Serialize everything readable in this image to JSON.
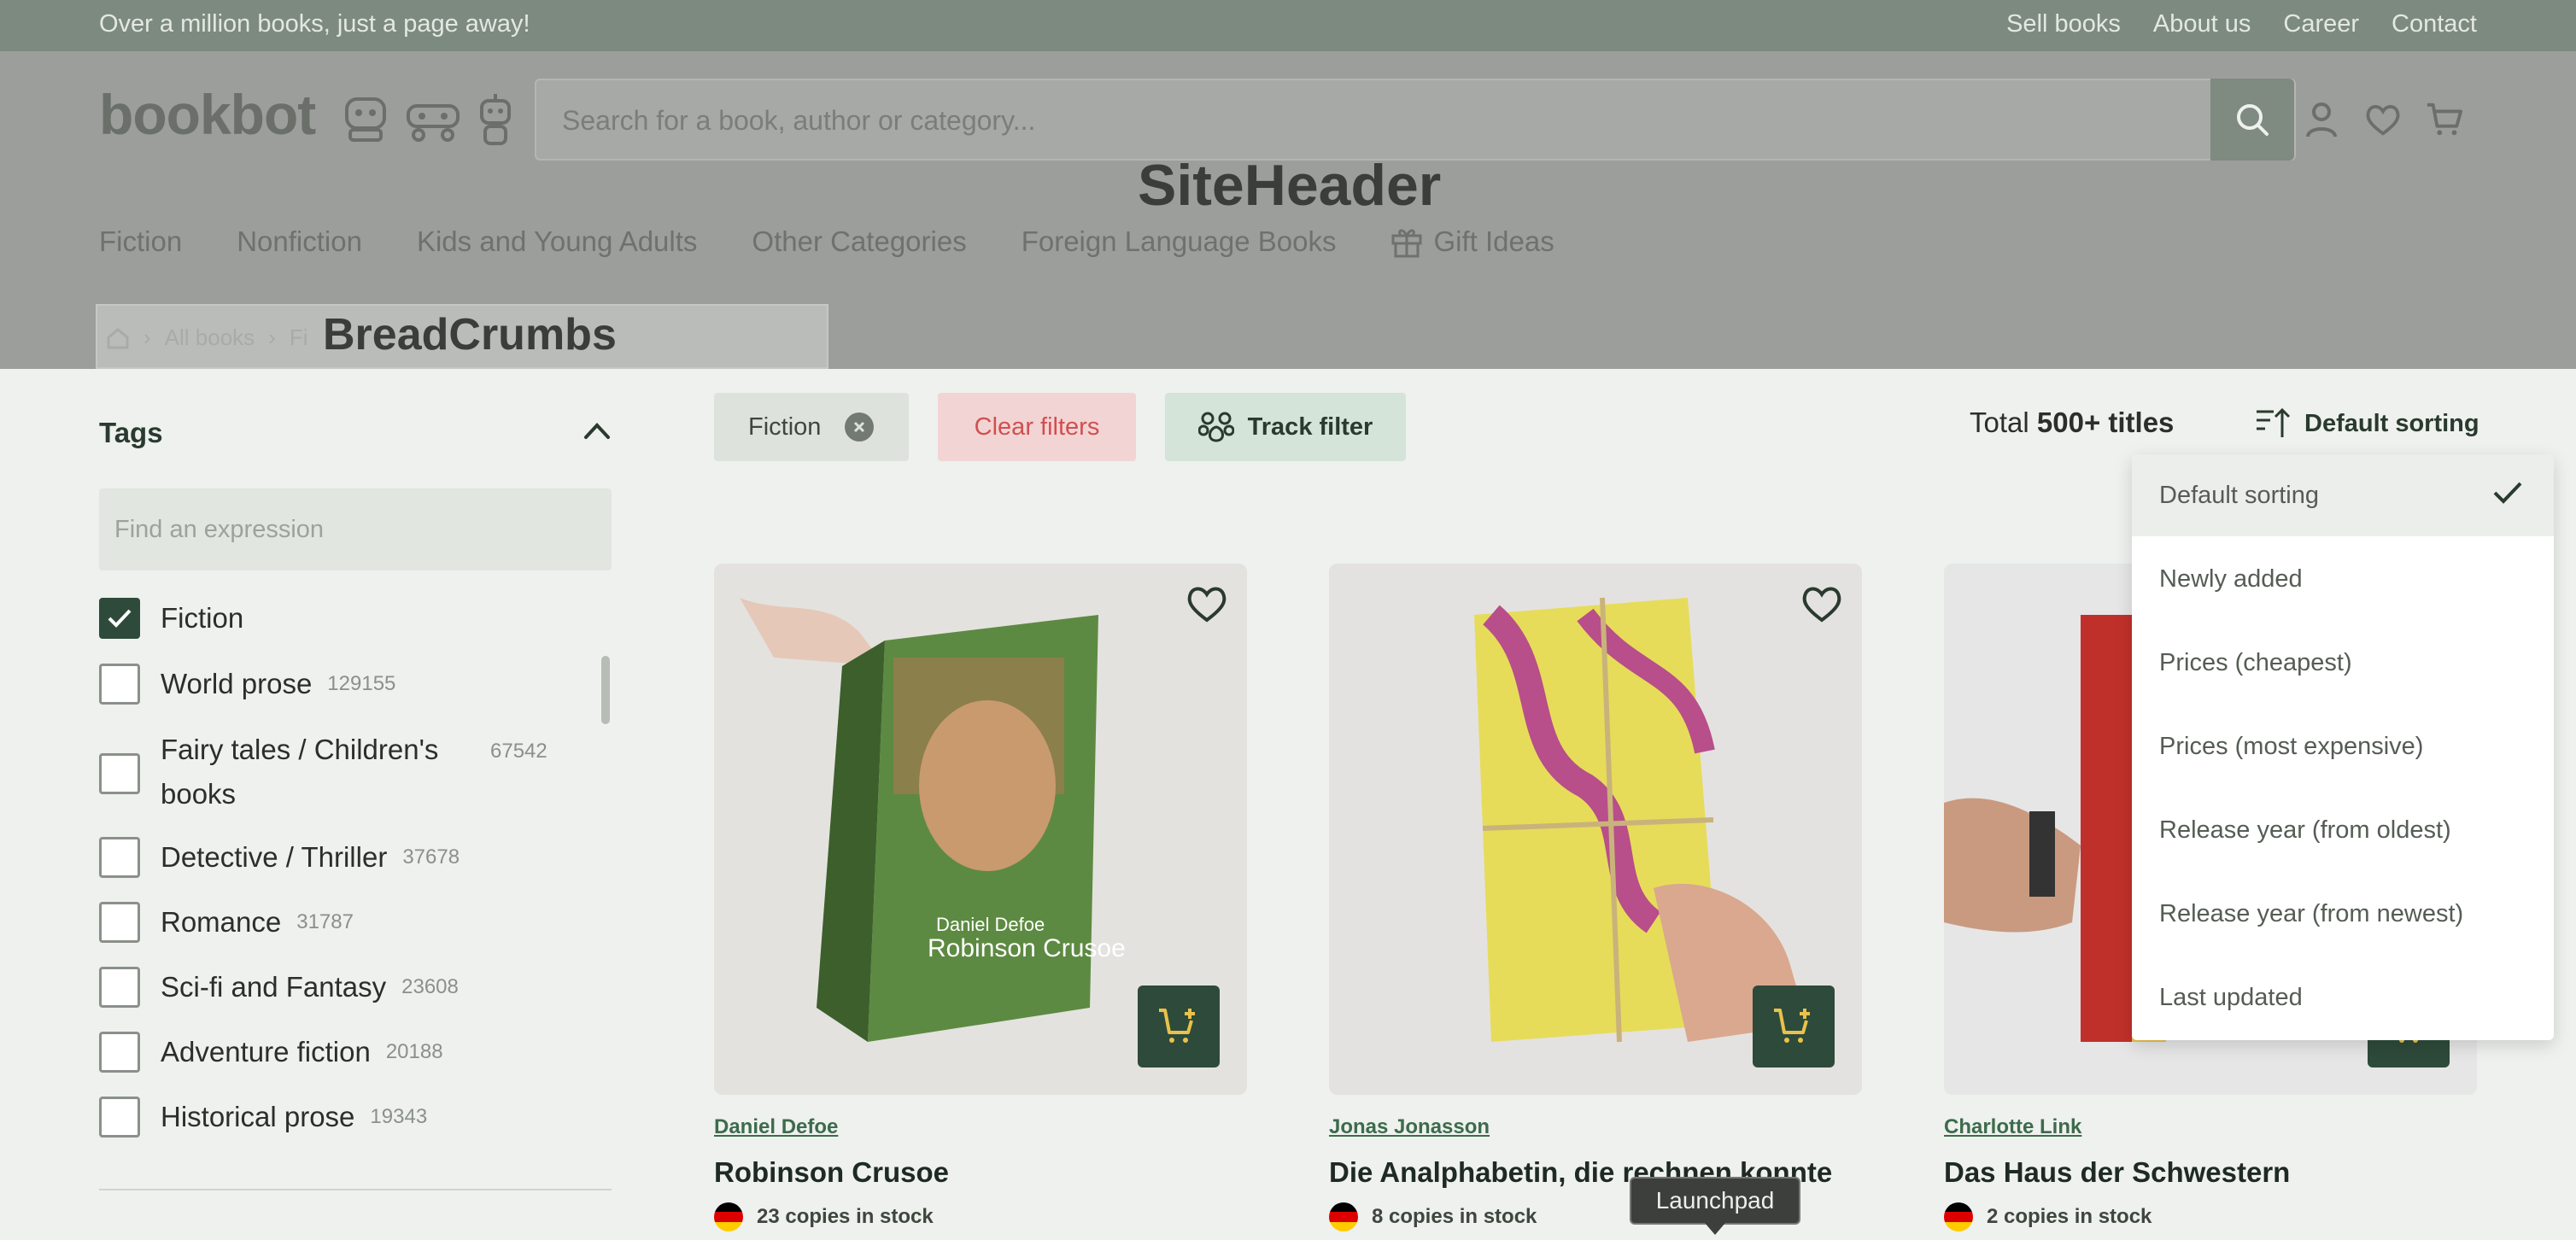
{
  "topbar": {
    "tagline": "Over a million books, just a page away!",
    "links": [
      "Sell books",
      "About us",
      "Career",
      "Contact"
    ]
  },
  "header": {
    "logo": "bookbot",
    "search_placeholder": "Search for a book, author or category...",
    "overlay_label": "SiteHeader",
    "nav": [
      "Fiction",
      "Nonfiction",
      "Kids and Young Adults",
      "Other Categories",
      "Foreign Language Books",
      "Gift Ideas"
    ]
  },
  "breadcrumbs": {
    "overlay_label": "BreadCrumbs",
    "items": [
      "All books",
      "Fi"
    ]
  },
  "sidebar": {
    "tags_title": "Tags",
    "find_placeholder": "Find an expression",
    "tags": [
      {
        "label": "Fiction",
        "count": "",
        "checked": true
      },
      {
        "label": "World prose",
        "count": "129155",
        "checked": false
      },
      {
        "label": "Fairy tales / Children's",
        "label2": "books",
        "count": "67542",
        "checked": false
      },
      {
        "label": "Detective / Thriller",
        "count": "37678",
        "checked": false
      },
      {
        "label": "Romance",
        "count": "31787",
        "checked": false
      },
      {
        "label": "Sci-fi and Fantasy",
        "count": "23608",
        "checked": false
      },
      {
        "label": "Adventure fiction",
        "count": "20188",
        "checked": false
      },
      {
        "label": "Historical prose",
        "count": "19343",
        "checked": false
      }
    ]
  },
  "filters": {
    "active_chip": "Fiction",
    "clear_label": "Clear filters",
    "track_label": "Track filter",
    "total_prefix": "Total",
    "total_value": "500+ titles",
    "sort_label": "Default sorting"
  },
  "sort_options": [
    {
      "label": "Default sorting",
      "selected": true
    },
    {
      "label": "Newly added",
      "selected": false
    },
    {
      "label": "Prices (cheapest)",
      "selected": false
    },
    {
      "label": "Prices (most expensive)",
      "selected": false
    },
    {
      "label": "Release year (from oldest)",
      "selected": false
    },
    {
      "label": "Release year (from newest)",
      "selected": false
    },
    {
      "label": "Last updated",
      "selected": false
    }
  ],
  "products": [
    {
      "author": "Daniel Defoe",
      "title": "Robinson Crusoe",
      "stock": "23 copies in stock"
    },
    {
      "author": "Jonas Jonasson",
      "title": "Die Analphabetin, die rechnen konnte",
      "stock": "8 copies in stock"
    },
    {
      "author": "Charlotte Link",
      "title": "Das Haus der Schwestern",
      "stock": "2 copies in stock"
    }
  ],
  "tooltip": "Launchpad",
  "colors": {
    "brand_dark_green": "#2e4a3a",
    "accent_green": "#3d6b4c",
    "clear_red": "#d05050",
    "overlay_gray": "#9b9e9b"
  }
}
